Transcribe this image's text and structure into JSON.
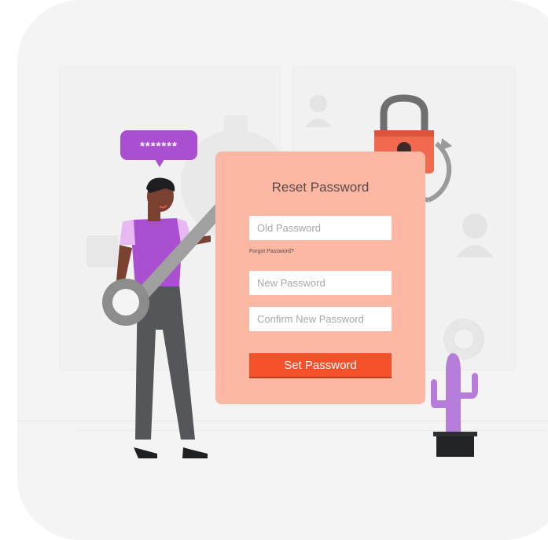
{
  "form": {
    "title": "Reset Password",
    "old_password_placeholder": "Old Password",
    "forgot_link": "Forgot Password?",
    "new_password_placeholder": "New Password",
    "confirm_password_placeholder": "Confirm New Password",
    "submit_label": "Set Password"
  },
  "speech_bubble": {
    "text": "*******"
  },
  "icons": [
    "gear-icon",
    "user-icon",
    "lock-icon",
    "refresh-icon",
    "key-icon",
    "cactus-icon"
  ],
  "colors": {
    "panel": "#fcb8a3",
    "button": "#f4502a",
    "accent_purple": "#a94fd0",
    "lock": "#f16a4f"
  }
}
